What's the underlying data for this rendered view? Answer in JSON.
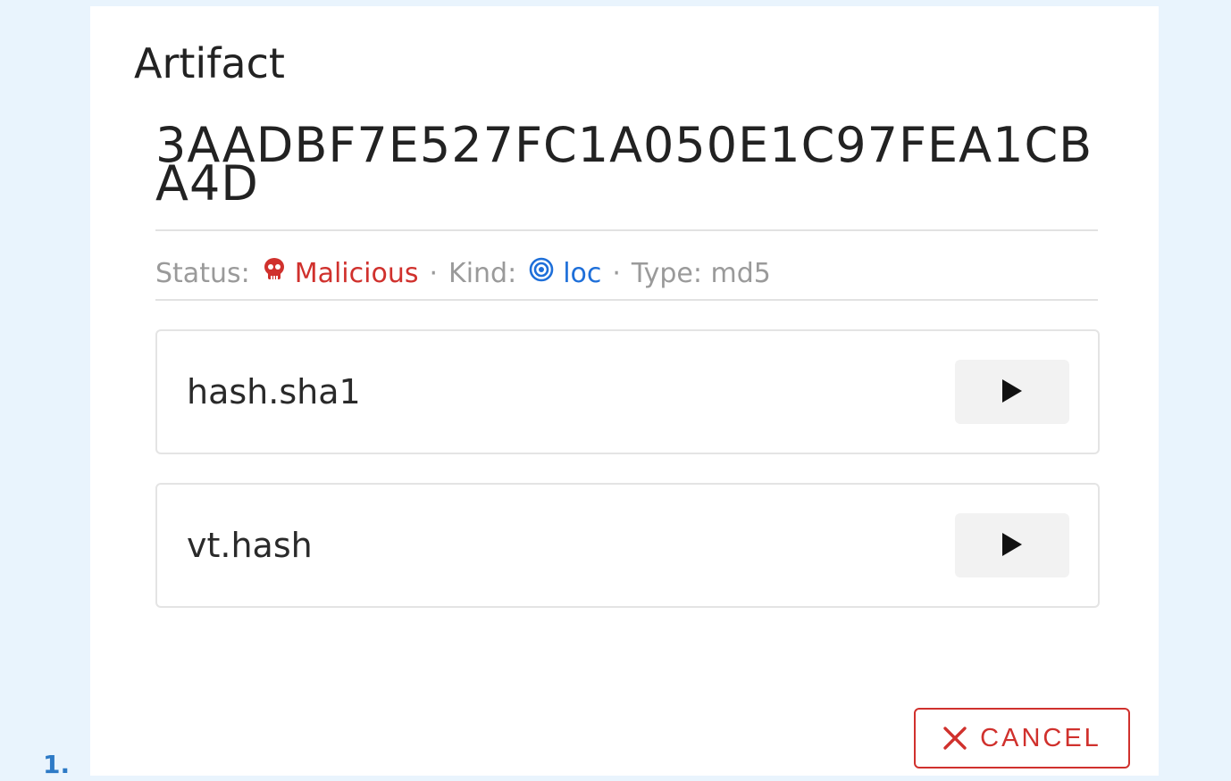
{
  "dialog": {
    "title": "Artifact",
    "artifact_value": "3AADBF7E527FC1A050E1C97FEA1CBA4D",
    "meta": {
      "status_label": "Status:",
      "status_value": "Malicious",
      "status_icon": "skull-icon",
      "sep1": "·",
      "kind_label": "Kind:",
      "kind_value": "loc",
      "kind_icon": "target-icon",
      "sep2": "·",
      "type_text": "Type: md5"
    },
    "cards": [
      {
        "label": "hash.sha1",
        "action_icon": "play-icon"
      },
      {
        "label": "vt.hash",
        "action_icon": "play-icon"
      }
    ],
    "cancel_label": "CANCEL"
  },
  "list_marker": "1.",
  "colors": {
    "background": "#e9f4fd",
    "malicious": "#d0312d",
    "kind": "#1e6fd9",
    "muted": "#9a9a9a"
  }
}
